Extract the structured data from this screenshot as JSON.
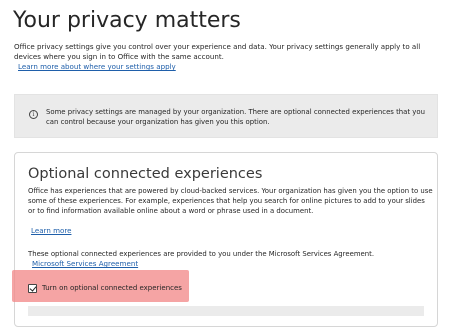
{
  "page": {
    "title": "Your privacy matters",
    "intro": "Office privacy settings give you control over your experience and data. Your privacy settings generally apply to all devices where you sign in to Office with the same account.",
    "intro_link": "Learn more about where your settings apply"
  },
  "info_bar": {
    "icon": "info-icon",
    "text": "Some privacy settings are managed by your organization. There are optional connected experiences that you can control because your organization has given you this option."
  },
  "optional_experiences": {
    "heading": "Optional connected experiences",
    "description": "Office has experiences that are powered by cloud-backed services. Your organization has given you the option to use some of these experiences. For example, experiences that help you search for online pictures to add to your slides or to find information available online about a word or phrase used in a document.",
    "learn_more": "Learn more",
    "provided_text": "These optional connected experiences are provided to you under the Microsoft Services Agreement.",
    "agreement_link": "Microsoft Services Agreement",
    "checkbox_label": "Turn on optional connected experiences",
    "checkbox_checked": true
  },
  "colors": {
    "link": "#1f5faa",
    "highlight": "#f28b8b",
    "info_bar_bg": "#ebebeb"
  }
}
